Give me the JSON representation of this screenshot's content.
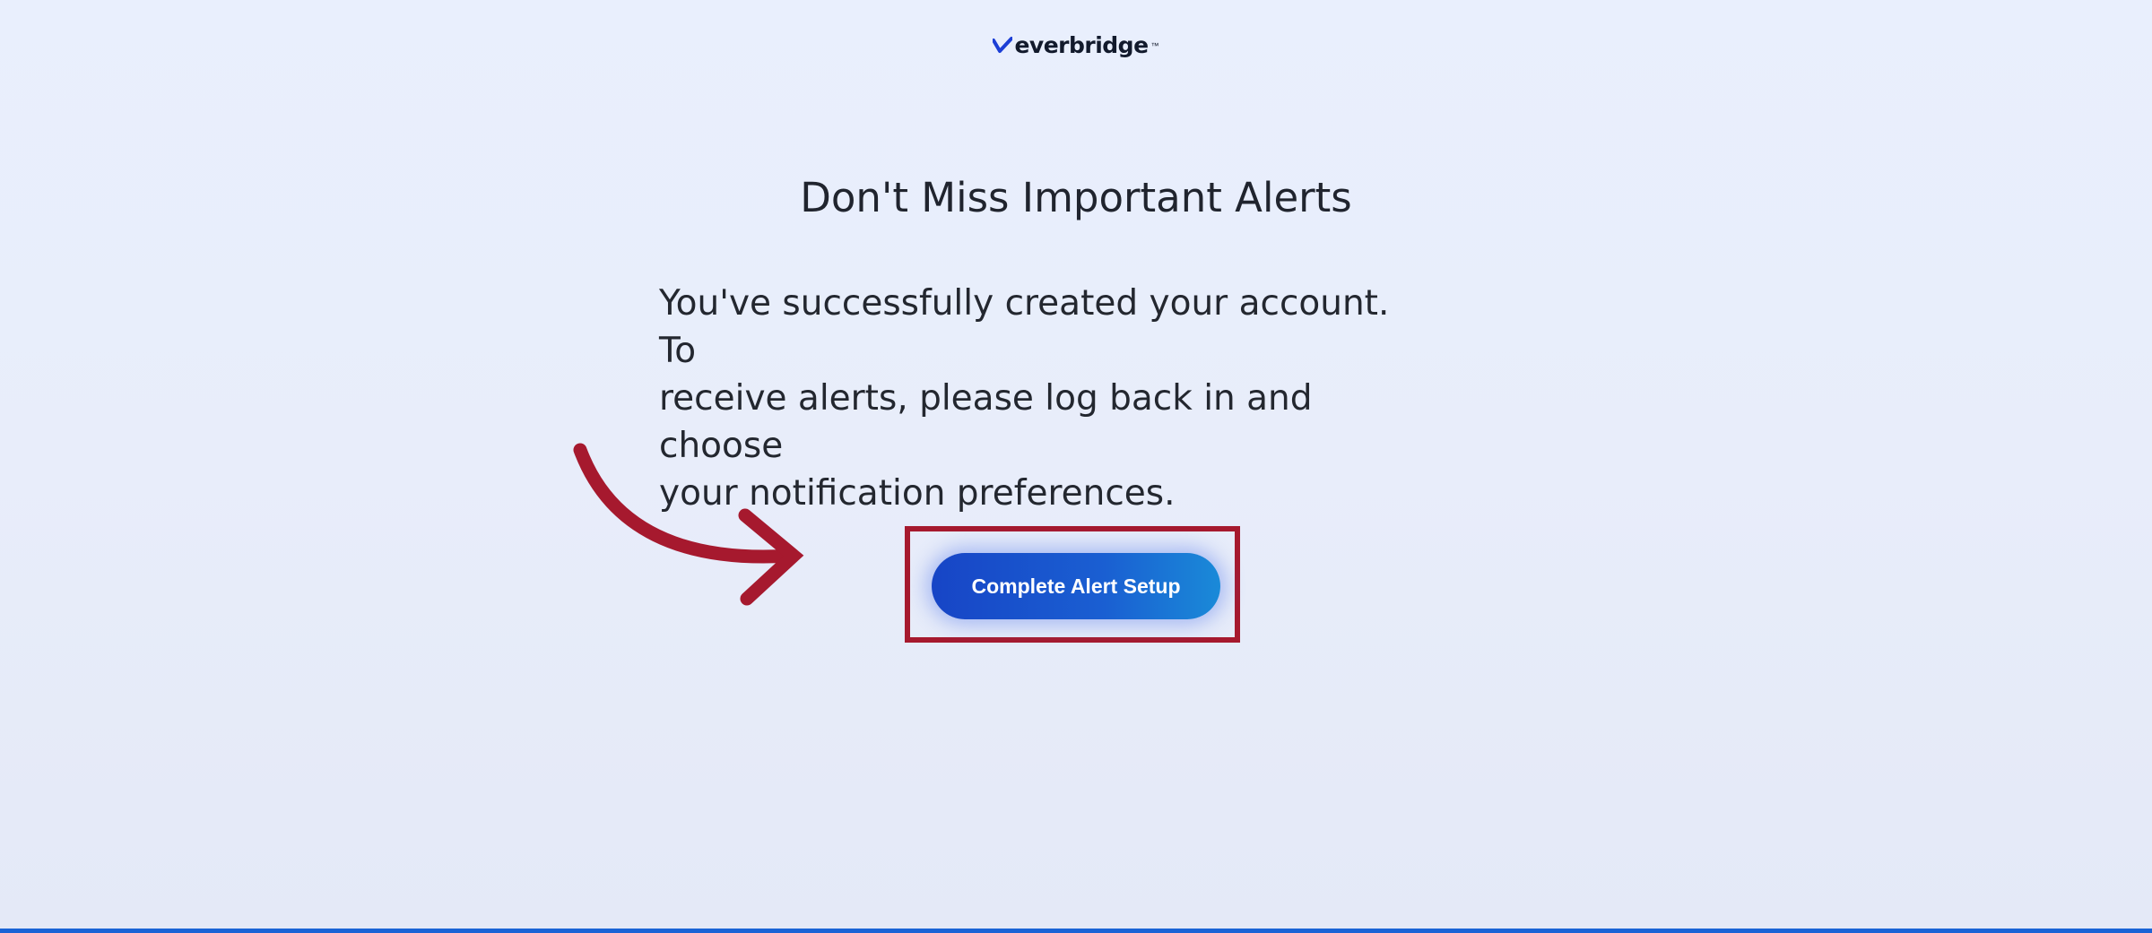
{
  "header": {
    "logo_text": "everbridge",
    "logo_tm": "™",
    "logo_icon": "everbridge-checkmark-icon"
  },
  "main": {
    "title": "Don't Miss Important Alerts",
    "message_lines": [
      "You've successfully created your account. To",
      "receive alerts, please log back in and choose",
      "your notification preferences."
    ],
    "cta_label": "Complete Alert Setup"
  },
  "annotation": {
    "arrow_icon": "curved-arrow-icon",
    "highlight": "highlight-box"
  },
  "colors": {
    "background": "#e9effd",
    "accent": "#1a5fd2",
    "annotation": "#a6192e",
    "bottom_bar": "#1a63d6"
  }
}
